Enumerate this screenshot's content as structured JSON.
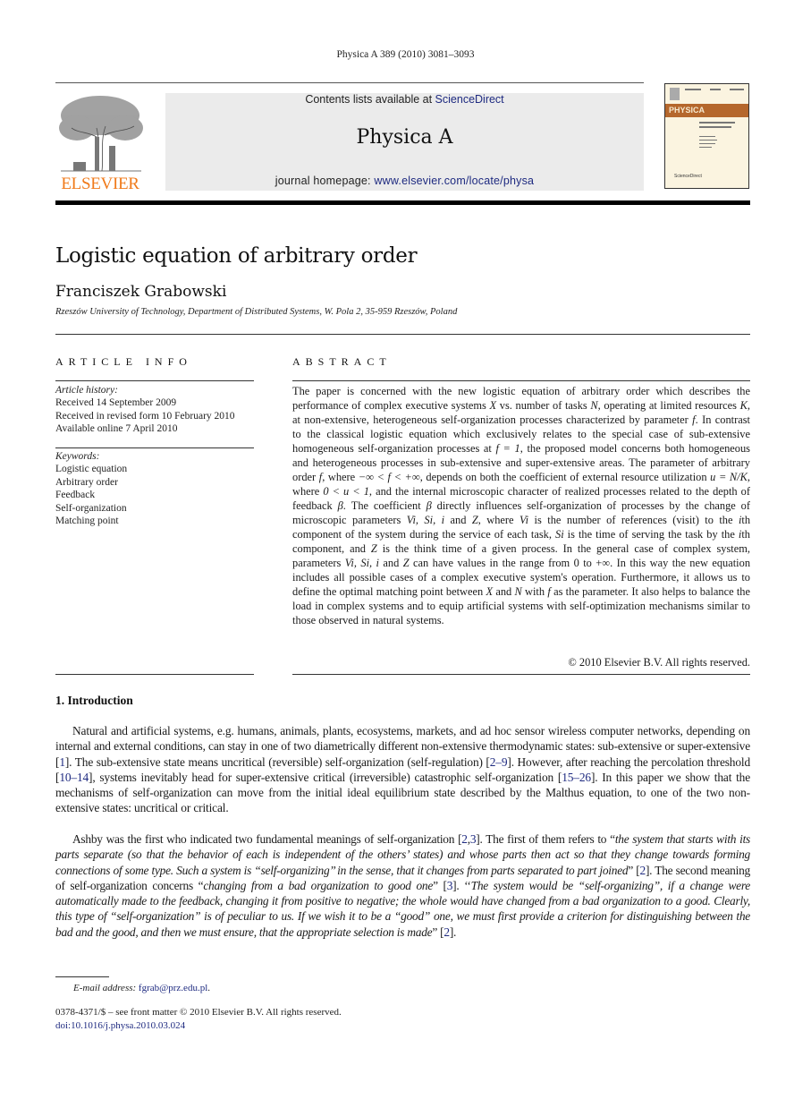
{
  "running_head": "Physica A 389 (2010) 3081–3093",
  "masthead": {
    "publisher_logo_word": "ELSEVIER",
    "contents_prefix": "Contents lists available at ",
    "contents_link": "ScienceDirect",
    "journal_name": "Physica A",
    "homepage_prefix": "journal homepage: ",
    "homepage_link": "www.elsevier.com/locate/physa",
    "cover_label": "PHYSICA",
    "cover_sd": "ScienceDirect",
    "icons": [
      "elsevier-tree-logo",
      "journal-cover-thumbnail"
    ],
    "colors": {
      "elsevier_orange": "#f07a1a",
      "link_blue": "#1e2a80",
      "masthead_grey": "#ebebeb",
      "cover_brown": "#b5672c"
    }
  },
  "article": {
    "title": "Logistic equation of arbitrary order",
    "author": "Franciszek Grabowski",
    "affiliation": "Rzeszów University of Technology, Department of Distributed Systems, W. Pola 2, 35-959 Rzeszów, Poland"
  },
  "article_info": {
    "heading": "ARTICLE INFO",
    "history_label": "Article history:",
    "history": [
      "Received 14 September 2009",
      "Received in revised form 10 February 2010",
      "Available online 7 April 2010"
    ],
    "keywords_label": "Keywords:",
    "keywords": [
      "Logistic equation",
      "Arbitrary order",
      "Feedback",
      "Self-organization",
      "Matching point"
    ]
  },
  "abstract": {
    "heading": "ABSTRACT",
    "segments": [
      "The paper is concerned with the new logistic equation of arbitrary order which describes the performance of complex executive systems ",
      "X",
      " vs. number of tasks ",
      "N",
      ", operating at limited resources ",
      "K",
      ", at non-extensive, heterogeneous self-organization processes characterized by parameter ",
      "f",
      ". In contrast to the classical logistic equation which exclusively relates to the special case of sub-extensive homogeneous self-organization processes at ",
      "f = 1",
      ", the proposed model concerns both homogeneous and heterogeneous processes in sub-extensive and super-extensive areas. The parameter of arbitrary order ",
      "f",
      ", where ",
      "−∞ < f < +∞",
      ", depends on both the coefficient of external resource utilization ",
      "u = N/K",
      ", where ",
      "0 < u < 1",
      ", and the internal microscopic character of realized processes related to the depth of feedback ",
      "β",
      ". The coefficient ",
      "β",
      " directly influences self-organization of processes by the change of microscopic parameters ",
      "Vi, Si, i",
      " and ",
      "Z",
      ", where ",
      "Vi",
      " is the number of references (visit) to the ",
      "i",
      "th component of the system during the service of each task, ",
      "Si",
      " is the time of serving the task by the ",
      "i",
      "th component, and ",
      "Z",
      " is the think time of a given process. In the general case of complex system, parameters ",
      "Vi, Si, i",
      " and ",
      "Z",
      " can have values in the range from 0 to +∞. In this way the new equation includes all possible cases of a complex executive system's operation. Furthermore, it allows us to define the optimal matching point between ",
      "X",
      " and ",
      "N",
      " with ",
      "f",
      " as the parameter. It also helps to balance the load in complex systems and to equip artificial systems with self-optimization mechanisms similar to those observed in natural systems."
    ],
    "copyright": "© 2010 Elsevier B.V. All rights reserved."
  },
  "introduction": {
    "heading": "1.  Introduction",
    "para1": [
      {
        "t": "Natural and artificial systems, e.g. humans, animals, plants, ecosystems, markets, and ad hoc sensor wireless computer networks, depending on internal and external conditions, can stay in one of two diametrically different non-extensive thermodynamic states: sub-extensive or super-extensive ["
      },
      {
        "r": "1"
      },
      {
        "t": "]. The sub-extensive state means uncritical (reversible) self-organization (self-regulation) ["
      },
      {
        "r": "2–9"
      },
      {
        "t": "]. However, after reaching the percolation threshold ["
      },
      {
        "r": "10–14"
      },
      {
        "t": "], systems inevitably head for super-extensive critical (irreversible) catastrophic self-organization ["
      },
      {
        "r": "15–26"
      },
      {
        "t": "]. In this paper we show that the mechanisms of self-organization can move from the initial ideal equilibrium state described by the Malthus equation, to one of the two non-extensive states: uncritical or critical."
      }
    ],
    "para2": [
      {
        "t": "Ashby was the first who indicated two fundamental meanings of self-organization ["
      },
      {
        "r": "2"
      },
      {
        "t": ","
      },
      {
        "r": "3"
      },
      {
        "t": "]. The first of them refers to “"
      },
      {
        "i": "the system that starts with its parts separate (so that the behavior of each is independent of the others’ states) and whose parts then act so that they change towards forming connections of some type. Such a system is “self-organizing’’ in the sense, that it changes from parts separated to part joined"
      },
      {
        "t": "” ["
      },
      {
        "r": "2"
      },
      {
        "t": "]. The second meaning of self-organization concerns “"
      },
      {
        "i": "changing from a bad organization to good one"
      },
      {
        "t": "” ["
      },
      {
        "r": "3"
      },
      {
        "t": "]. ‘‘"
      },
      {
        "i": "The system would be “self-organizing”, if a change were automatically made to the feedback, changing it from positive to negative; the whole would have changed from a bad organization to a good. Clearly, this type of “self-organization” is of peculiar to us. If we wish it to be a “good” one, we must first provide a criterion for distinguishing between the bad and the good, and then we must ensure, that the appropriate selection is made"
      },
      {
        "t": "” ["
      },
      {
        "r": "2"
      },
      {
        "t": "]."
      }
    ]
  },
  "footer": {
    "email_label": "E-mail address:",
    "email": "fgrab@prz.edu.pl",
    "email_trailer": ".",
    "issn": "0378-4371/$ – see front matter © 2010 Elsevier B.V. All rights reserved.",
    "doi": "doi:10.1016/j.physa.2010.03.024"
  }
}
